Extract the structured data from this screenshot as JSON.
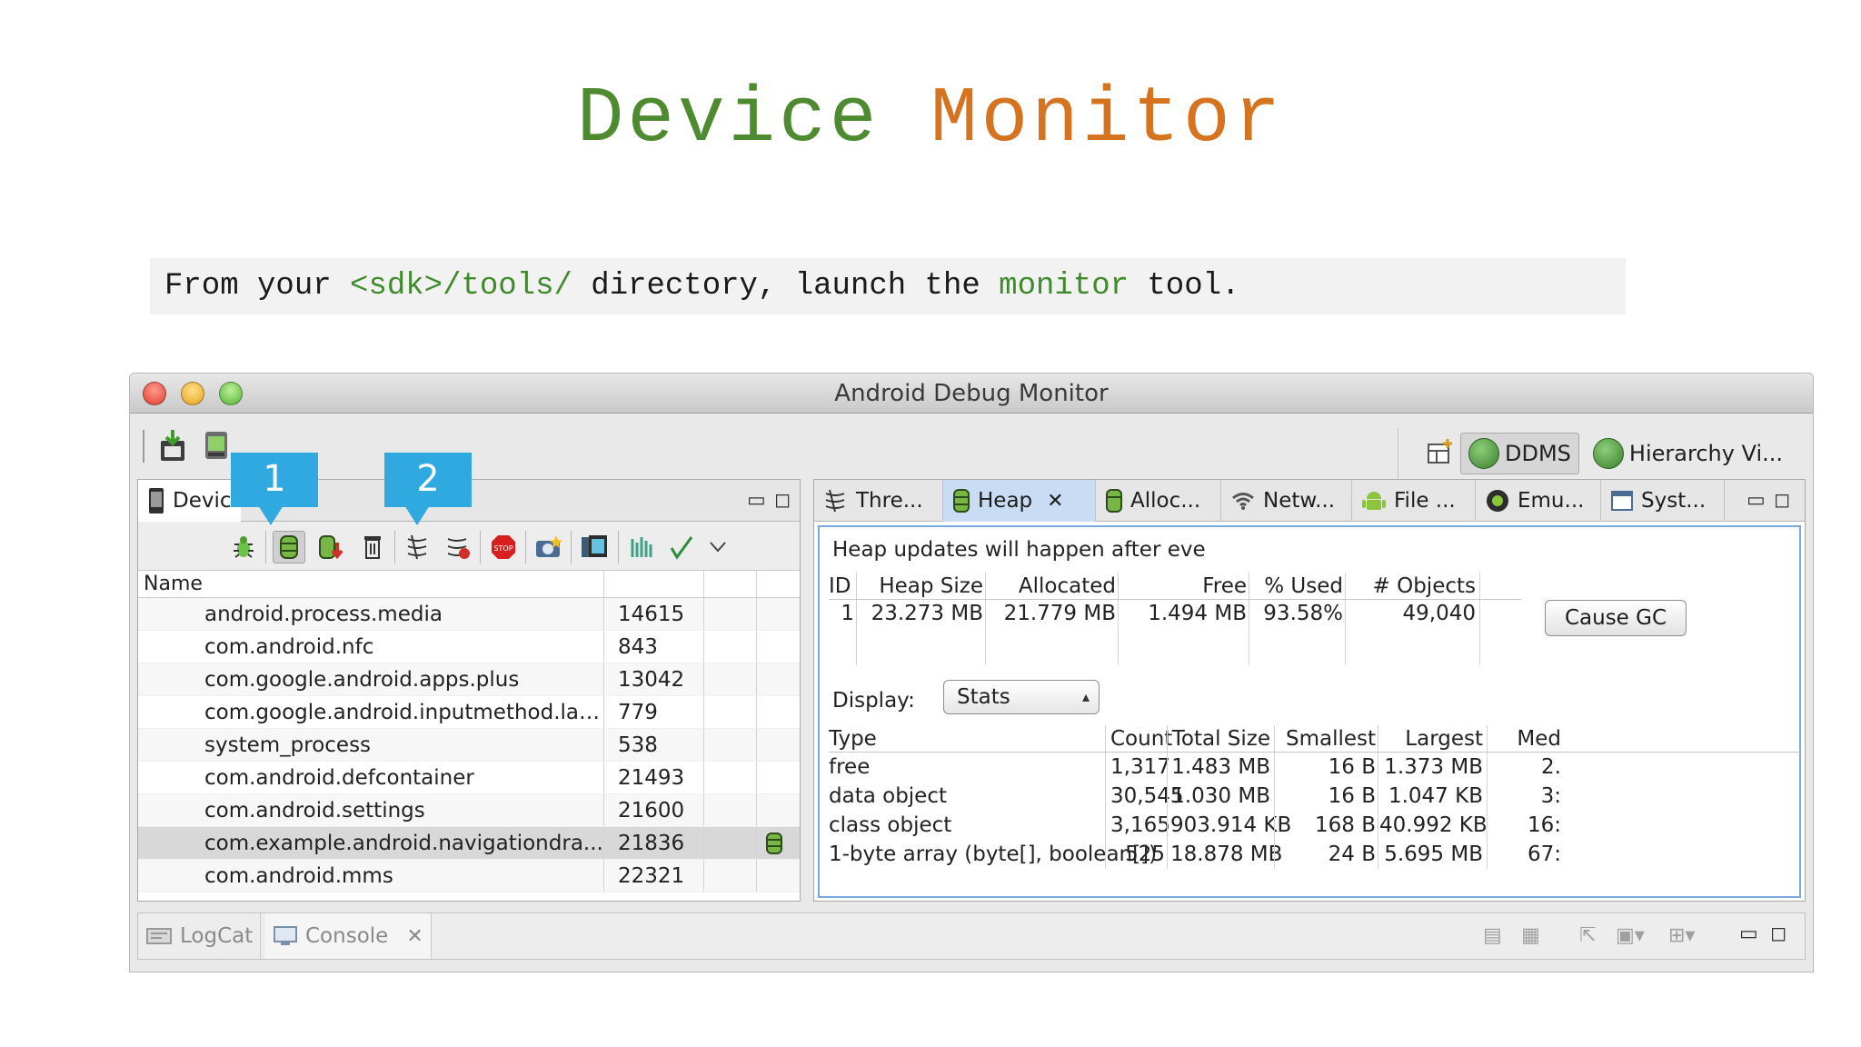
{
  "slide": {
    "title_word1": "Device",
    "title_word2": "Monitor",
    "instruction_pre": "From your ",
    "instruction_path": "<sdk>/tools/",
    "instruction_mid": " directory, launch the ",
    "instruction_cmd": "monitor",
    "instruction_post": " tool."
  },
  "window": {
    "title": "Android Debug Monitor",
    "perspectives": [
      "DDMS",
      "Hierarchy Vi..."
    ]
  },
  "devices_panel": {
    "tab_label": "Devic",
    "columns": [
      "Name"
    ],
    "rows": [
      {
        "name": "android.process.media",
        "pid": "14615"
      },
      {
        "name": "com.android.nfc",
        "pid": "843"
      },
      {
        "name": "com.google.android.apps.plus",
        "pid": "13042"
      },
      {
        "name": "com.google.android.inputmethod.latin",
        "pid": "779"
      },
      {
        "name": "system_process",
        "pid": "538"
      },
      {
        "name": "com.android.defcontainer",
        "pid": "21493"
      },
      {
        "name": "com.android.settings",
        "pid": "21600"
      },
      {
        "name": "com.example.android.navigationdra...",
        "pid": "21836"
      },
      {
        "name": "com.android.mms",
        "pid": "22321"
      }
    ]
  },
  "callouts": [
    "1",
    "2"
  ],
  "right_tabs": [
    "Thre...",
    "Heap",
    "Alloc...",
    "Netw...",
    "File ...",
    "Emu...",
    "Syst..."
  ],
  "heap": {
    "message": "Heap updates will happen after eve",
    "summary_columns": [
      "ID",
      "Heap Size",
      "Allocated",
      "Free",
      "% Used",
      "# Objects"
    ],
    "summary_row": [
      "1",
      "23.273 MB",
      "21.779 MB",
      "1.494 MB",
      "93.58%",
      "49,040"
    ],
    "cause_gc": "Cause GC",
    "display_label": "Display:",
    "display_value": "Stats",
    "type_columns": [
      "Type",
      "Count",
      "Total Size",
      "Smallest",
      "Largest",
      "Med"
    ],
    "type_rows": [
      [
        "free",
        "1,317",
        "1.483 MB",
        "16 B",
        "1.373 MB",
        "2."
      ],
      [
        "data object",
        "30,545",
        "1.030 MB",
        "16 B",
        "1.047 KB",
        "3:"
      ],
      [
        "class object",
        "3,165",
        "903.914 KB",
        "168 B",
        "40.992 KB",
        "16:"
      ],
      [
        "1-byte array (byte[], boolean[])",
        "525",
        "18.878 MB",
        "24 B",
        "5.695 MB",
        "67:"
      ]
    ]
  },
  "bottom_tabs": [
    "LogCat",
    "Console"
  ],
  "colors": {
    "accent_green": "#4e8a2f",
    "accent_orange": "#d5731f",
    "callout_blue": "#2fa9e0",
    "heap_border": "#7aa7dc"
  }
}
